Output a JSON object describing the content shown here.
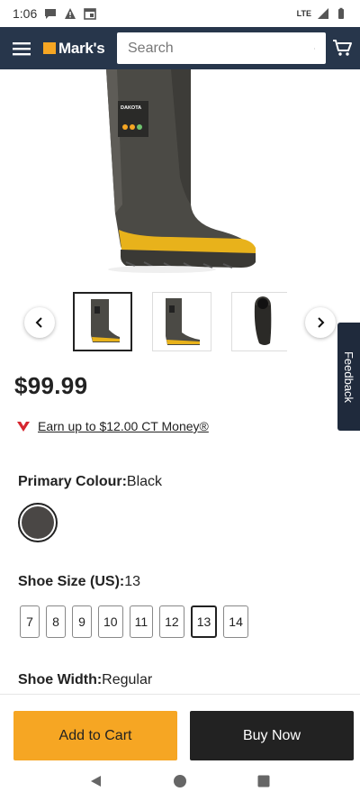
{
  "status_bar": {
    "time": "1:06",
    "network": "LTE",
    "icons": [
      "chat-bubble-icon",
      "alert-triangle-icon",
      "calendar-icon",
      "signal-icon",
      "battery-icon"
    ]
  },
  "header": {
    "logo_text": "Mark's",
    "search_placeholder": "Search",
    "icons": [
      "hamburger-menu-icon",
      "search-icon",
      "cart-icon"
    ],
    "background": "#27364b",
    "accent": "#f6a623"
  },
  "product": {
    "price": "$99.99",
    "ct_money": "Earn up to $12.00 CT Money®",
    "brand_label": "DAKOTA",
    "primary_colour_label": "Primary Colour:",
    "primary_colour_value": "Black",
    "shoe_size_label": "Shoe Size (US):",
    "shoe_size_value": "13",
    "sizes": [
      "7",
      "8",
      "9",
      "10",
      "11",
      "12",
      "13",
      "14"
    ],
    "selected_size": "13",
    "shoe_width_label": "Shoe Width:",
    "shoe_width_value": "Regular"
  },
  "feedback": {
    "label": "Feedback"
  },
  "actions": {
    "add_to_cart": "Add to Cart",
    "buy_now": "Buy Now"
  },
  "android_nav": {
    "icons": [
      "back-triangle-icon",
      "home-circle-icon",
      "recents-square-icon"
    ]
  }
}
